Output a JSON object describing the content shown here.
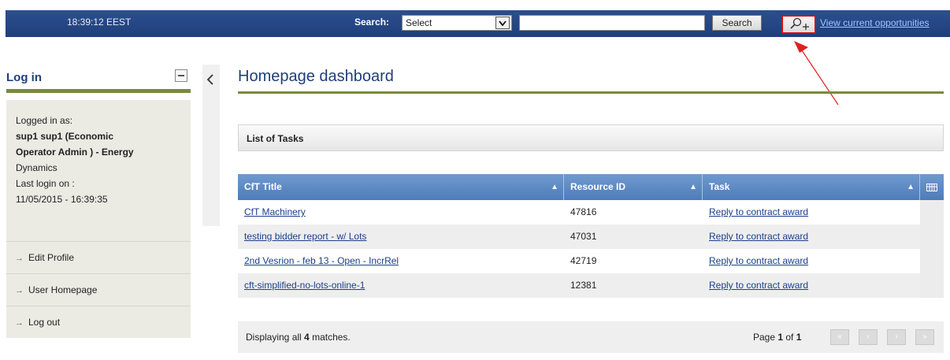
{
  "header": {
    "clock": "18:39:12 EEST",
    "search_label": "Search:",
    "select_value": "Select",
    "search_input_value": "",
    "search_button": "Search",
    "advanced_search_icon": "search-plus-icon",
    "view_opportunities": "View current opportunities"
  },
  "sidebar": {
    "title": "Log in",
    "logged_in_as_label": "Logged in as:",
    "user_line1": "sup1 sup1 (Economic",
    "user_line2": "Operator Admin ) - Energy",
    "user_line3": "Dynamics",
    "last_login_label": "Last login on :",
    "last_login_value": "11/05/2015 - 16:39:35",
    "links": [
      "Edit Profile",
      "User Homepage",
      "Log out"
    ]
  },
  "main": {
    "title": "Homepage dashboard",
    "panel_title": "List of Tasks",
    "columns": [
      "CfT Title",
      "Resource ID",
      "Task"
    ],
    "rows": [
      {
        "title": "CfT Machinery",
        "resource_id": "47816",
        "task": "Reply to contract award"
      },
      {
        "title": "testing bidder report - w/ Lots",
        "resource_id": "47031",
        "task": "Reply to contract award"
      },
      {
        "title": "2nd Vesrion - feb 13 - Open - IncrRel",
        "resource_id": "42719",
        "task": "Reply to contract award"
      },
      {
        "title": "cft-simplified-no-lots-online-1",
        "resource_id": "12381",
        "task": "Reply to contract award"
      }
    ],
    "footer_prefix": "Displaying all ",
    "footer_count": "4",
    "footer_suffix": " matches.",
    "page_prefix": "Page ",
    "page_current": "1",
    "page_of": " of ",
    "page_total": "1"
  },
  "colors": {
    "topbar": "#1f3f7a",
    "accent_rule": "#7a8a3a",
    "grid_header": "#5a86c2",
    "annotation": "#e02020"
  }
}
